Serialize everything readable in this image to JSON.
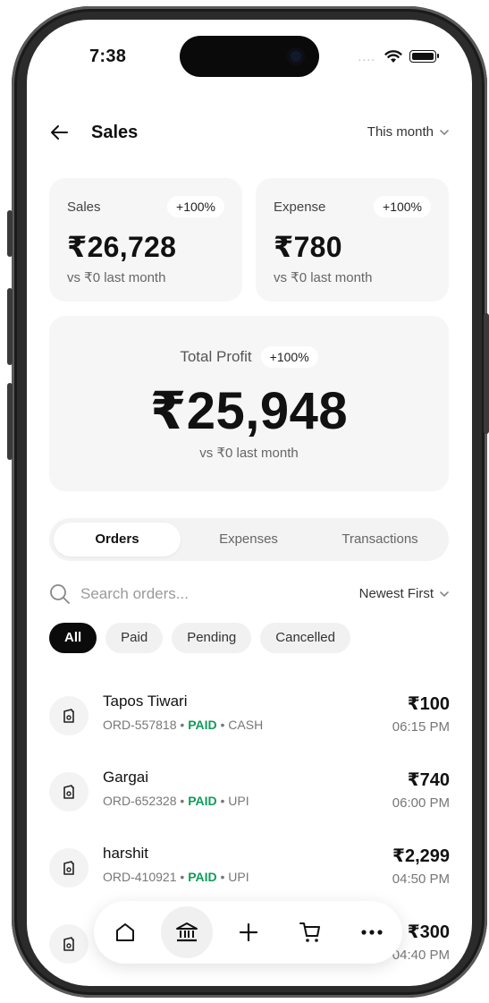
{
  "status": {
    "time": "7:38",
    "signal_dots": "...."
  },
  "header": {
    "title": "Sales",
    "period": "This month"
  },
  "sales_card": {
    "label": "Sales",
    "badge": "+100%",
    "amount": "₹26,728",
    "compare": "vs ₹0 last month"
  },
  "expense_card": {
    "label": "Expense",
    "badge": "+100%",
    "amount": "₹780",
    "compare": "vs ₹0 last month"
  },
  "profit_card": {
    "label": "Total Profit",
    "badge": "+100%",
    "amount": "₹25,948",
    "compare": "vs ₹0 last month"
  },
  "tabs": [
    {
      "label": "Orders",
      "active": true
    },
    {
      "label": "Expenses",
      "active": false
    },
    {
      "label": "Transactions",
      "active": false
    }
  ],
  "search": {
    "placeholder": "Search orders...",
    "sort": "Newest First"
  },
  "filters": [
    {
      "label": "All",
      "active": true
    },
    {
      "label": "Paid",
      "active": false
    },
    {
      "label": "Pending",
      "active": false
    },
    {
      "label": "Cancelled",
      "active": false
    }
  ],
  "orders": [
    {
      "name": "Tapos Tiwari",
      "id": "ORD-557818",
      "status": "PAID",
      "method": "CASH",
      "amount": "₹100",
      "time": "06:15 PM"
    },
    {
      "name": "Gargai",
      "id": "ORD-652328",
      "status": "PAID",
      "method": "UPI",
      "amount": "₹740",
      "time": "06:00 PM"
    },
    {
      "name": "harshit",
      "id": "ORD-410921",
      "status": "PAID",
      "method": "UPI",
      "amount": "₹2,299",
      "time": "04:50 PM"
    },
    {
      "name": "",
      "id": "",
      "status": "",
      "method": "",
      "amount": "₹300",
      "time": "04:40 PM"
    }
  ],
  "separator": "•",
  "bottom_nav": [
    {
      "icon": "home-icon",
      "active": false
    },
    {
      "icon": "bank-icon",
      "active": true
    },
    {
      "icon": "plus-icon",
      "active": false
    },
    {
      "icon": "cart-icon",
      "active": false
    },
    {
      "icon": "more-icon",
      "active": false
    }
  ],
  "colors": {
    "paid": "#119b5b",
    "active_chip": "#0b0b0b",
    "card_bg": "#f6f6f6"
  }
}
